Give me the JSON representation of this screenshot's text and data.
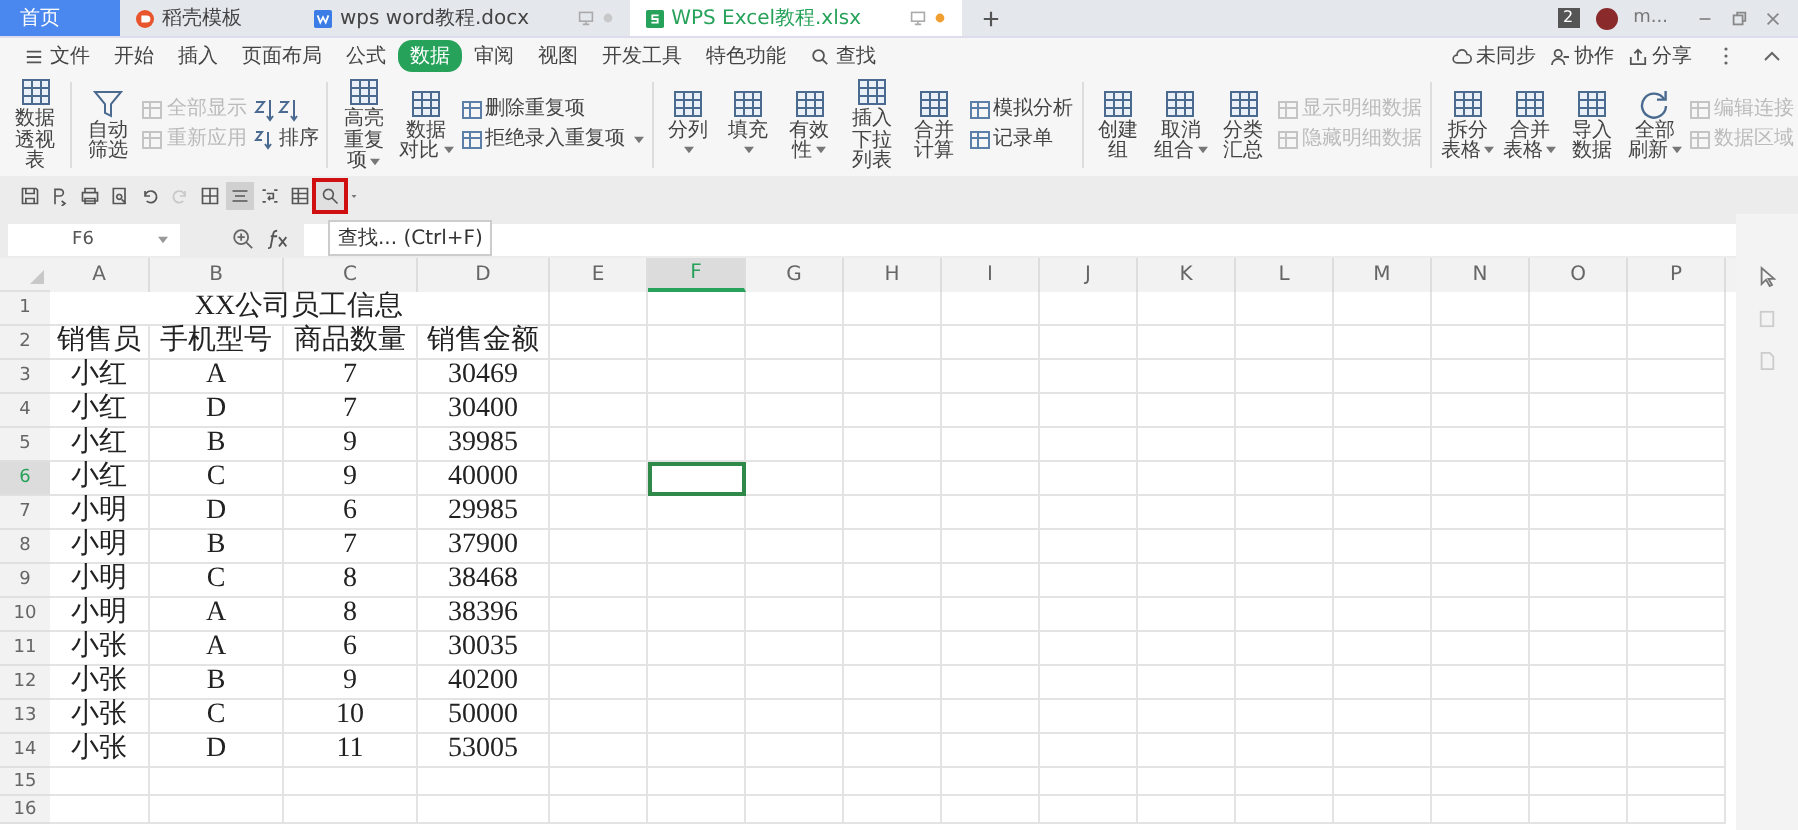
{
  "tabs": [
    {
      "label": "首页",
      "kind": "home",
      "selected": false
    },
    {
      "label": "稻壳模板",
      "kind": "template",
      "selected": false
    },
    {
      "label": "wps word教程.docx",
      "kind": "word",
      "selected": false,
      "unsaved": false
    },
    {
      "label": "WPS Excel教程.xlsx",
      "kind": "sheet",
      "selected": true,
      "unsaved": true
    }
  ],
  "account": {
    "badge": "2",
    "user": "m..."
  },
  "menu": [
    {
      "label": "文件",
      "kind": "file",
      "selected": false
    },
    {
      "label": "开始",
      "kind": "tab",
      "selected": false
    },
    {
      "label": "插入",
      "kind": "tab",
      "selected": false
    },
    {
      "label": "页面布局",
      "kind": "tab",
      "selected": false
    },
    {
      "label": "公式",
      "kind": "tab",
      "selected": false
    },
    {
      "label": "数据",
      "kind": "tab",
      "selected": true
    },
    {
      "label": "审阅",
      "kind": "tab",
      "selected": false
    },
    {
      "label": "视图",
      "kind": "tab",
      "selected": false
    },
    {
      "label": "开发工具",
      "kind": "tab",
      "selected": false
    },
    {
      "label": "特色功能",
      "kind": "tab",
      "selected": false
    },
    {
      "label": "查找",
      "kind": "search",
      "selected": false
    }
  ],
  "menu_actions": [
    {
      "label": "未同步",
      "kind": "cloud"
    },
    {
      "label": "协作",
      "kind": "person"
    },
    {
      "label": "分享",
      "kind": "share"
    }
  ],
  "ribbon": [
    {
      "items": [
        {
          "kind": "button",
          "label": "数据透视表",
          "dropdown": false
        }
      ]
    },
    {
      "items": [
        {
          "kind": "filter",
          "label": "自动筛选",
          "dropdown": false
        },
        {
          "kind": "stack",
          "items": [
            {
              "label": "全部显示",
              "disabled": true,
              "dropdown": false
            },
            {
              "label": "重新应用",
              "disabled": true,
              "dropdown": false
            }
          ]
        },
        {
          "kind": "sort",
          "label": "排序"
        }
      ]
    },
    {
      "items": [
        {
          "kind": "button",
          "label": "高亮重复项",
          "dropdown": true
        },
        {
          "kind": "button",
          "label": "数据对比",
          "dropdown": true
        },
        {
          "kind": "stack",
          "items": [
            {
              "label": "删除重复项",
              "disabled": false,
              "dropdown": false
            },
            {
              "label": "拒绝录入重复项",
              "disabled": false,
              "dropdown": true
            }
          ]
        }
      ]
    },
    {
      "items": [
        {
          "kind": "button",
          "label": "分列",
          "dropdown": true
        },
        {
          "kind": "button",
          "label": "填充",
          "dropdown": true
        },
        {
          "kind": "button",
          "label": "有效性",
          "dropdown": true
        },
        {
          "kind": "button",
          "label": "插入下拉列表",
          "dropdown": false
        },
        {
          "kind": "button",
          "label": "合并计算",
          "dropdown": false
        },
        {
          "kind": "stack",
          "items": [
            {
              "label": "模拟分析",
              "disabled": false,
              "dropdown": false
            },
            {
              "label": "记录单",
              "disabled": false,
              "dropdown": false
            }
          ]
        }
      ]
    },
    {
      "items": [
        {
          "kind": "button",
          "label": "创建组",
          "dropdown": false
        },
        {
          "kind": "button",
          "label": "取消组合",
          "dropdown": true
        },
        {
          "kind": "button",
          "label": "分类汇总",
          "dropdown": false
        },
        {
          "kind": "stack",
          "items": [
            {
              "label": "显示明细数据",
              "disabled": true,
              "dropdown": false
            },
            {
              "label": "隐藏明细数据",
              "disabled": true,
              "dropdown": false
            }
          ]
        }
      ]
    },
    {
      "items": [
        {
          "kind": "button",
          "label": "拆分表格",
          "dropdown": true
        },
        {
          "kind": "button",
          "label": "合并表格",
          "dropdown": true
        },
        {
          "kind": "button",
          "label": "导入数据",
          "dropdown": false
        },
        {
          "kind": "refresh",
          "label": "全部刷新",
          "dropdown": true
        },
        {
          "kind": "stack",
          "items": [
            {
              "label": "编辑连接",
              "disabled": true,
              "dropdown": false
            },
            {
              "label": "数据区域",
              "disabled": true,
              "dropdown": false
            }
          ]
        }
      ]
    }
  ],
  "quick_toolbar": [
    {
      "kind": "save",
      "disabled": false,
      "pressed": false,
      "highlighted": false
    },
    {
      "kind": "export",
      "disabled": false,
      "pressed": false,
      "highlighted": false
    },
    {
      "kind": "print",
      "disabled": false,
      "pressed": false,
      "highlighted": false
    },
    {
      "kind": "preview",
      "disabled": false,
      "pressed": false,
      "highlighted": false
    },
    {
      "kind": "undo",
      "disabled": false,
      "pressed": false,
      "highlighted": false
    },
    {
      "kind": "redo",
      "disabled": true,
      "pressed": false,
      "highlighted": false
    },
    {
      "kind": "border",
      "disabled": false,
      "pressed": false,
      "highlighted": false
    },
    {
      "kind": "align",
      "disabled": false,
      "pressed": true,
      "highlighted": false
    },
    {
      "kind": "wrap",
      "disabled": false,
      "pressed": false,
      "highlighted": false
    },
    {
      "kind": "table",
      "disabled": false,
      "pressed": false,
      "highlighted": false
    },
    {
      "kind": "find",
      "disabled": false,
      "pressed": false,
      "highlighted": true
    },
    {
      "kind": "more",
      "disabled": false,
      "pressed": false,
      "highlighted": false
    }
  ],
  "tooltip": "查找... (Ctrl+F)",
  "formula_bar": {
    "name_box": "F6"
  },
  "sheet": {
    "columns": [
      {
        "label": "A",
        "selected": false
      },
      {
        "label": "B",
        "selected": false
      },
      {
        "label": "C",
        "selected": false
      },
      {
        "label": "D",
        "selected": false
      },
      {
        "label": "E",
        "selected": false
      },
      {
        "label": "F",
        "selected": true
      },
      {
        "label": "G",
        "selected": false
      },
      {
        "label": "H",
        "selected": false
      },
      {
        "label": "I",
        "selected": false
      },
      {
        "label": "J",
        "selected": false
      },
      {
        "label": "K",
        "selected": false
      },
      {
        "label": "L",
        "selected": false
      },
      {
        "label": "M",
        "selected": false
      },
      {
        "label": "N",
        "selected": false
      },
      {
        "label": "O",
        "selected": false
      },
      {
        "label": "P",
        "selected": false
      }
    ],
    "rows": [
      {
        "number": "1",
        "kind": "title",
        "selected": false,
        "title": "XX公司员工信息"
      },
      {
        "number": "2",
        "kind": "data",
        "selected": false,
        "cells": [
          "销售员",
          "手机型号",
          "商品数量",
          "销售金额"
        ]
      },
      {
        "number": "3",
        "kind": "data",
        "selected": false,
        "cells": [
          "小红",
          "A",
          "7",
          "30469"
        ]
      },
      {
        "number": "4",
        "kind": "data",
        "selected": false,
        "cells": [
          "小红",
          "D",
          "7",
          "30400"
        ]
      },
      {
        "number": "5",
        "kind": "data",
        "selected": false,
        "cells": [
          "小红",
          "B",
          "9",
          "39985"
        ]
      },
      {
        "number": "6",
        "kind": "data",
        "selected": true,
        "cells": [
          "小红",
          "C",
          "9",
          "40000"
        ]
      },
      {
        "number": "7",
        "kind": "data",
        "selected": false,
        "cells": [
          "小明",
          "D",
          "6",
          "29985"
        ]
      },
      {
        "number": "8",
        "kind": "data",
        "selected": false,
        "cells": [
          "小明",
          "B",
          "7",
          "37900"
        ]
      },
      {
        "number": "9",
        "kind": "data",
        "selected": false,
        "cells": [
          "小明",
          "C",
          "8",
          "38468"
        ]
      },
      {
        "number": "10",
        "kind": "data",
        "selected": false,
        "cells": [
          "小明",
          "A",
          "8",
          "38396"
        ]
      },
      {
        "number": "11",
        "kind": "data",
        "selected": false,
        "cells": [
          "小张",
          "A",
          "6",
          "30035"
        ]
      },
      {
        "number": "12",
        "kind": "data",
        "selected": false,
        "cells": [
          "小张",
          "B",
          "9",
          "40200"
        ]
      },
      {
        "number": "13",
        "kind": "data",
        "selected": false,
        "cells": [
          "小张",
          "C",
          "10",
          "50000"
        ]
      },
      {
        "number": "14",
        "kind": "data",
        "selected": false,
        "cells": [
          "小张",
          "D",
          "11",
          "53005"
        ]
      },
      {
        "number": "15",
        "kind": "empty",
        "selected": false
      },
      {
        "number": "16",
        "kind": "empty",
        "selected": false
      }
    ]
  }
}
